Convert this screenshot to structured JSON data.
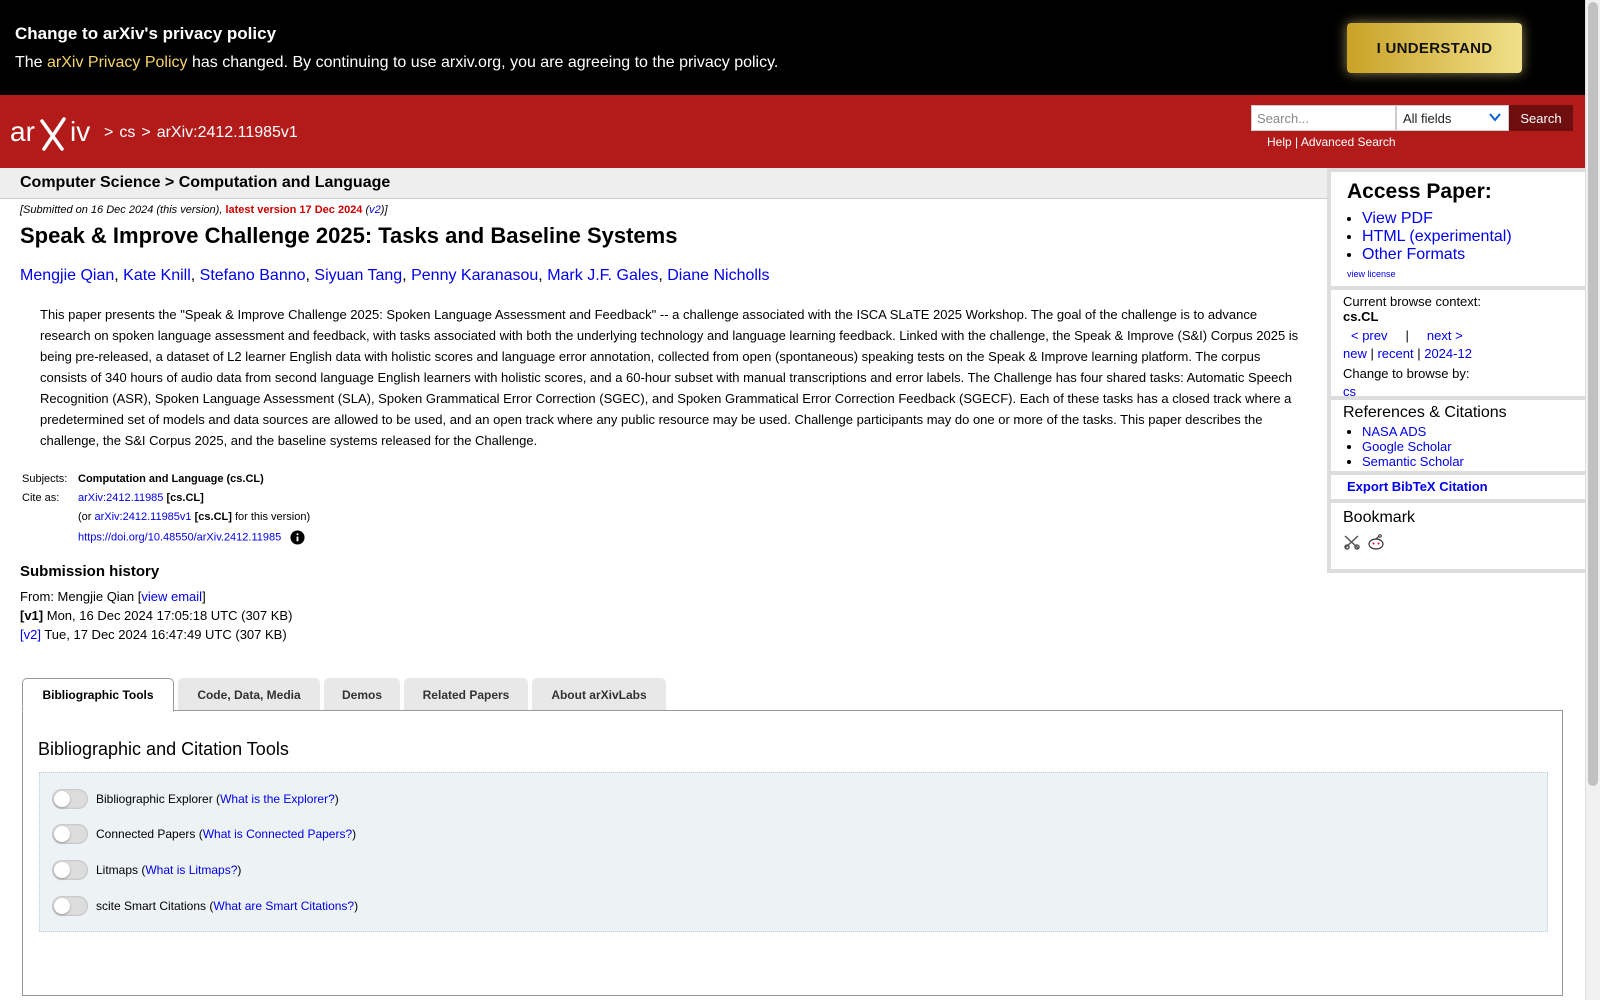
{
  "banner": {
    "title": "Change to arXiv's privacy policy",
    "text_before": "The ",
    "link": "arXiv Privacy Policy",
    "text_after": " has changed. By continuing to use arxiv.org, you are agreeing to the privacy policy.",
    "button": "I UNDERSTAND"
  },
  "header": {
    "breadcrumb": [
      ">",
      "cs",
      ">",
      "arXiv:2412.11985v1"
    ],
    "search_placeholder": "Search...",
    "field_select": "All fields",
    "search_button": "Search",
    "help": "Help",
    "sep": " | ",
    "advanced": "Advanced Search"
  },
  "subheader": "Computer Science > Computation and Language",
  "paper": {
    "dateline_pre": "[Submitted on 16 Dec 2024 (this version), ",
    "dateline_latest": "latest version 17 Dec 2024",
    "dateline_mid": " (",
    "dateline_v2": "v2",
    "dateline_post": ")]",
    "title": "Speak & Improve Challenge 2025: Tasks and Baseline Systems",
    "authors": [
      "Mengjie Qian",
      "Kate Knill",
      "Stefano Banno",
      "Siyuan Tang",
      "Penny Karanasou",
      "Mark J.F. Gales",
      "Diane Nicholls"
    ],
    "abstract": "This paper presents the \"Speak & Improve Challenge 2025: Spoken Language Assessment and Feedback\" -- a challenge associated with the ISCA SLaTE 2025 Workshop. The goal of the challenge is to advance research on spoken language assessment and feedback, with tasks associated with both the underlying technology and language learning feedback. Linked with the challenge, the Speak & Improve (S&I) Corpus 2025 is being pre-released, a dataset of L2 learner English data with holistic scores and language error annotation, collected from open (spontaneous) speaking tests on the Speak & Improve learning platform. The corpus consists of 340 hours of audio data from second language English learners with holistic scores, and a 60-hour subset with manual transcriptions and error labels. The Challenge has four shared tasks: Automatic Speech Recognition (ASR), Spoken Language Assessment (SLA), Spoken Grammatical Error Correction (SGEC), and Spoken Grammatical Error Correction Feedback (SGECF). Each of these tasks has a closed track where a predetermined set of models and data sources are allowed to be used, and an open track where any public resource may be used. Challenge participants may do one or more of the tasks. This paper describes the challenge, the S&I Corpus 2025, and the baseline systems released for the Challenge.",
    "subjects_label": "Subjects:",
    "subjects": "Computation and Language (cs.CL)",
    "cite_label": "Cite as:",
    "cite_id": "arXiv:2412.11985",
    "cite_cat": "[cs.CL]",
    "cite2_pre": "(or ",
    "cite2_id": "arXiv:2412.11985v1",
    "cite2_cat": "[cs.CL]",
    "cite2_post": " for this version)",
    "doi": "https://doi.org/10.48550/arXiv.2412.11985",
    "history_title": "Submission history",
    "from_pre": "From: Mengjie Qian [",
    "from_link": "view email",
    "from_post": "]",
    "v1_label": "[v1]",
    "v1_text": " Mon, 16 Dec 2024 17:05:18 UTC (307 KB)",
    "v2_label": "[v2]",
    "v2_text": " Tue, 17 Dec 2024 16:47:49 UTC (307 KB)"
  },
  "panel": {
    "access_title": "Access Paper:",
    "access_links": [
      "View PDF",
      "HTML (experimental)",
      "Other Formats"
    ],
    "view_license": "view license",
    "context_label": "Current browse context:",
    "context": "cs.CL",
    "prev": "< prev",
    "sep": "|",
    "next": "next >",
    "new": "new",
    "recent": "recent",
    "month": "2024-12",
    "pipe": " | ",
    "change_label": "Change to browse by:",
    "change_cs": "cs",
    "refs_title": "References & Citations",
    "refs": [
      "NASA ADS",
      "Google Scholar",
      "Semantic Scholar"
    ],
    "export": "Export BibTeX Citation",
    "bookmark": "Bookmark"
  },
  "tabs": [
    "Bibliographic Tools",
    "Code, Data, Media",
    "Demos",
    "Related Papers",
    "About arXivLabs"
  ],
  "tools": {
    "title": "Bibliographic and Citation Tools",
    "items": [
      {
        "label": "Bibliographic Explorer (",
        "link": "What is the Explorer?",
        "close": ")"
      },
      {
        "label": "Connected Papers (",
        "link": "What is Connected Papers?",
        "close": ")"
      },
      {
        "label": "Litmaps (",
        "link": "What is Litmaps?",
        "close": ")"
      },
      {
        "label": "scite Smart Citations (",
        "link": "What are Smart Citations?",
        "close": ")"
      }
    ]
  },
  "colors": {
    "header": "#b31b1b",
    "banner": "#000000",
    "button_gold": "#e8c95a",
    "link": "#0000ee"
  }
}
